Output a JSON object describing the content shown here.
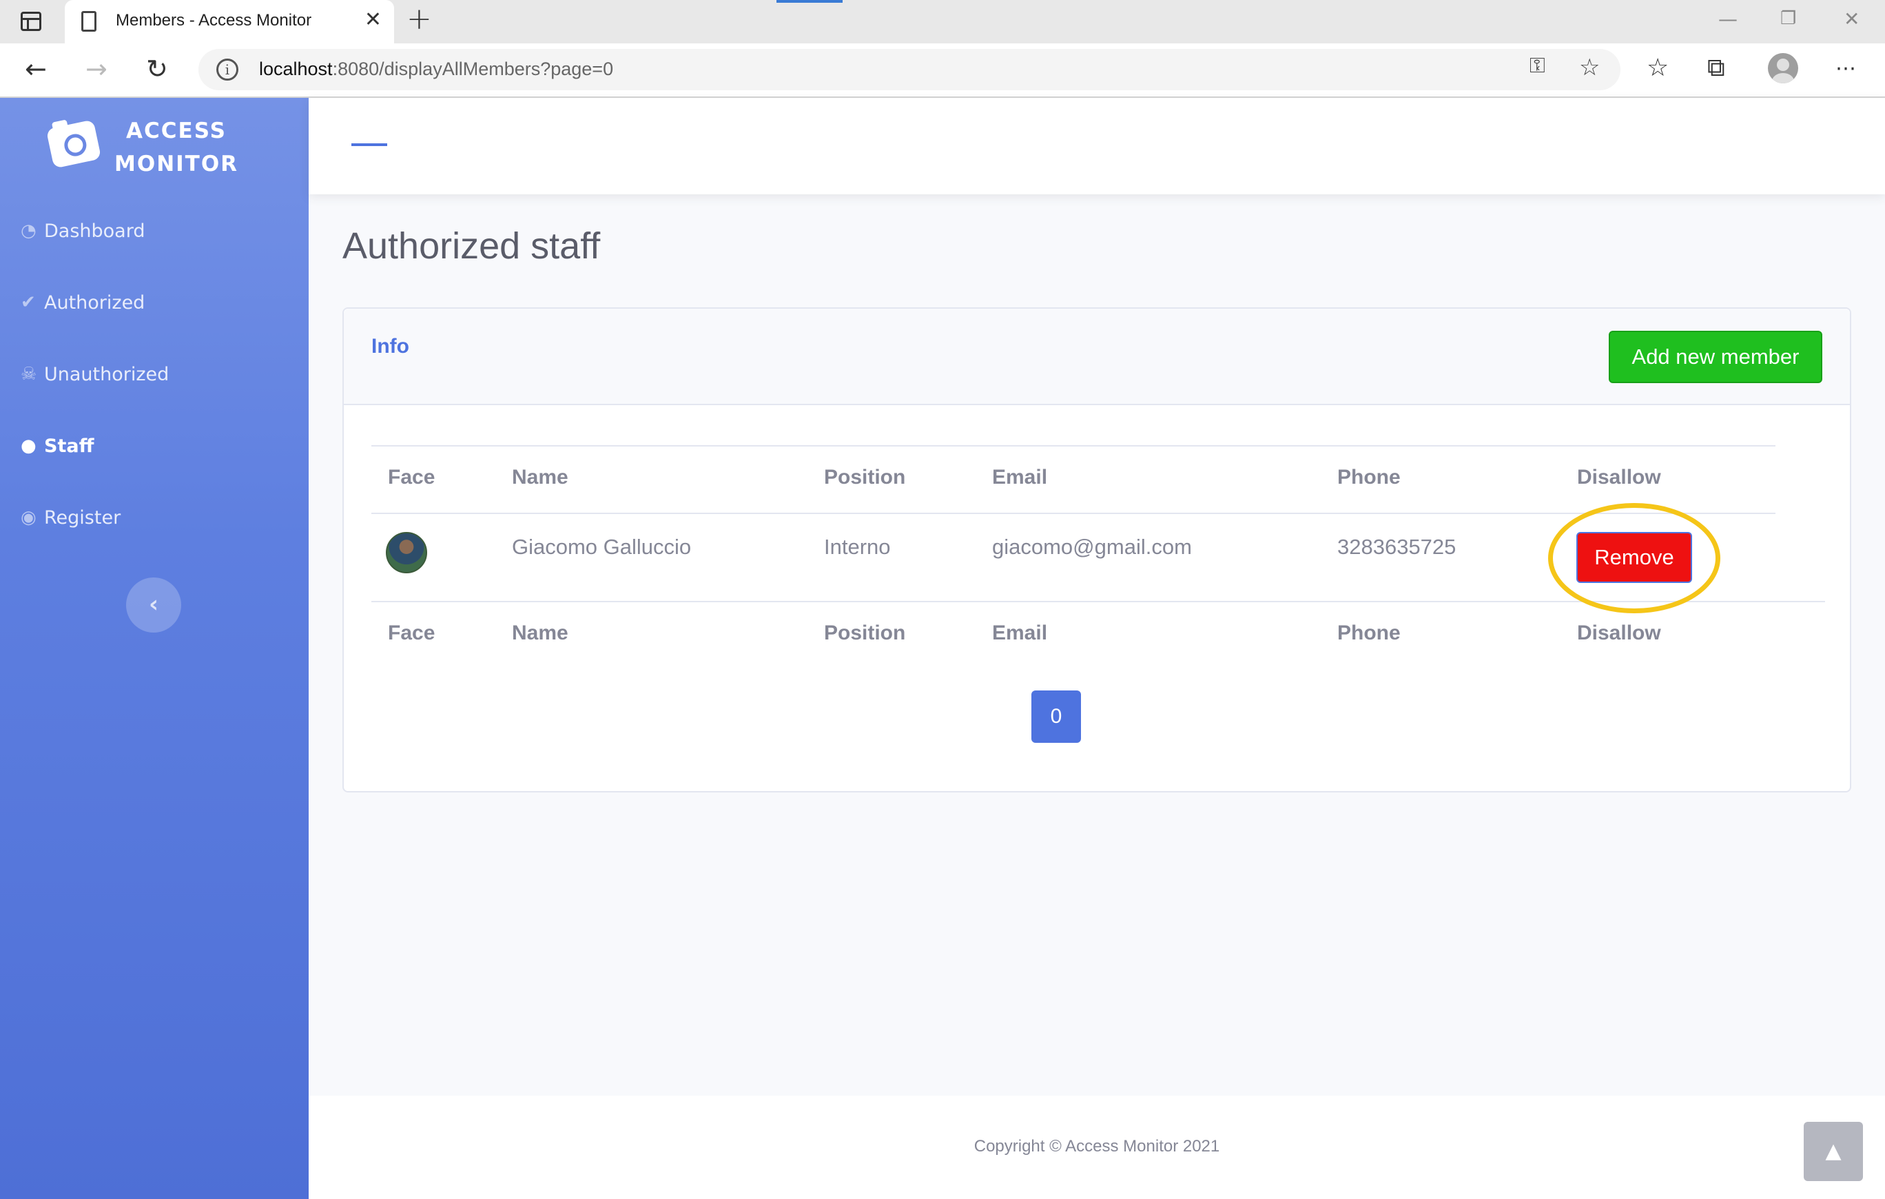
{
  "browser": {
    "tab_title": "Members - Access Monitor",
    "url_host": "localhost",
    "url_rest": ":8080/displayAllMembers?page=0"
  },
  "sidebar": {
    "brand_line1": "ACCESS",
    "brand_line2": "MONITOR",
    "items": [
      {
        "label": "Dashboard",
        "icon": "tachometer-icon"
      },
      {
        "label": "Authorized",
        "icon": "user-check-icon"
      },
      {
        "label": "Unauthorized",
        "icon": "user-secret-icon"
      },
      {
        "label": "Staff",
        "icon": "user-icon",
        "active": true
      },
      {
        "label": "Register",
        "icon": "user-circle-icon"
      }
    ]
  },
  "page": {
    "title": "Authorized staff"
  },
  "card": {
    "header_title": "Info",
    "add_button": "Add new member"
  },
  "table": {
    "headers": [
      "Face",
      "Name",
      "Position",
      "Email",
      "Phone",
      "Disallow"
    ],
    "rows": [
      {
        "name": "Giacomo Galluccio",
        "position": "Interno",
        "email": "giacomo@gmail.com",
        "phone": "3283635725",
        "action": "Remove"
      }
    ]
  },
  "pagination": {
    "current_page": "0"
  },
  "footer": {
    "copyright": "Copyright © Access Monitor 2021"
  },
  "colors": {
    "primary": "#4e73df",
    "success": "#1fbf1f",
    "danger": "#ee1111",
    "highlight": "#f5c518"
  }
}
